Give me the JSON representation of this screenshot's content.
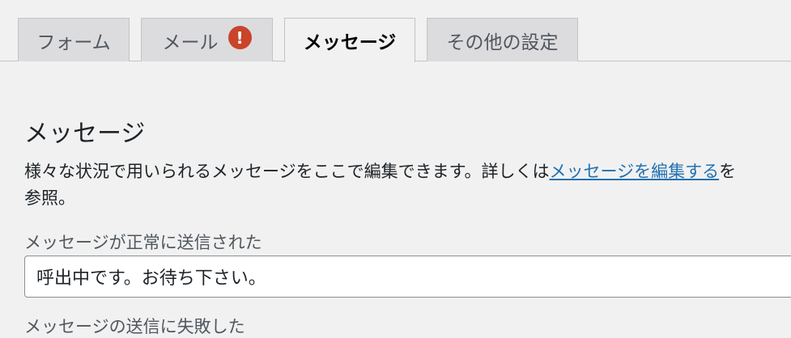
{
  "tabs": [
    {
      "label": "フォーム",
      "active": false
    },
    {
      "label": "メール",
      "active": false,
      "badge": "!"
    },
    {
      "label": "メッセージ",
      "active": true
    },
    {
      "label": "その他の設定",
      "active": false
    }
  ],
  "section": {
    "title": "メッセージ",
    "description_prefix": "様々な状況で用いられるメッセージをここで編集できます。詳しくは",
    "description_link": "メッセージを編集する",
    "description_suffix": "を",
    "description_line2": "参照。"
  },
  "fields": [
    {
      "label": "メッセージが正常に送信された",
      "value": "呼出中です。お待ち下さい。"
    },
    {
      "label": "メッセージの送信に失敗した"
    }
  ],
  "colors": {
    "badge": "#c9442a",
    "link": "#2271b1",
    "background": "#f1f1f1"
  }
}
